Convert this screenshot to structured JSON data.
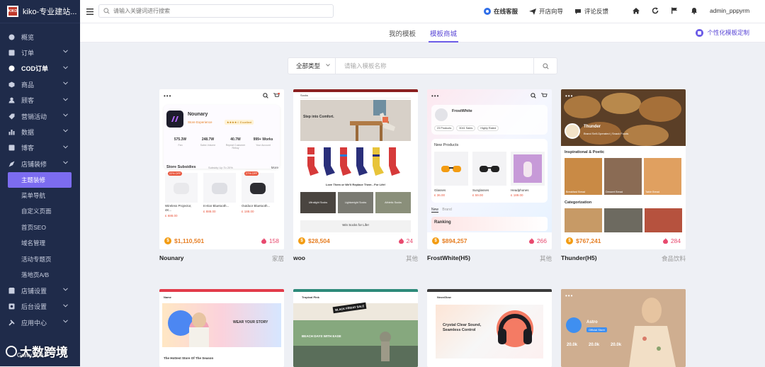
{
  "brand": {
    "name": "kiko-专业建站...",
    "logo_text": "KIKO"
  },
  "sidebar": {
    "items": [
      {
        "label": "概览",
        "icon": "dashboard-icon",
        "expandable": false
      },
      {
        "label": "订单",
        "icon": "order-icon",
        "expandable": true
      },
      {
        "label": "COD订单",
        "icon": "cod-icon",
        "expandable": true
      },
      {
        "label": "商品",
        "icon": "product-icon",
        "expandable": true
      },
      {
        "label": "顾客",
        "icon": "customer-icon",
        "expandable": true
      },
      {
        "label": "营销活动",
        "icon": "marketing-icon",
        "expandable": true
      },
      {
        "label": "数据",
        "icon": "data-icon",
        "expandable": true
      },
      {
        "label": "博客",
        "icon": "blog-icon",
        "expandable": true
      },
      {
        "label": "店铺装修",
        "icon": "decoration-icon",
        "expandable": true
      }
    ],
    "sub_items": [
      "主题装修",
      "菜单导航",
      "自定义页面",
      "首页SEO",
      "域名管理",
      "活动专题页",
      "落地页A/B"
    ],
    "bottom_items": [
      {
        "label": "店铺设置",
        "icon": "store-settings-icon"
      },
      {
        "label": "后台设置",
        "icon": "admin-settings-icon"
      },
      {
        "label": "应用中心",
        "icon": "app-center-icon"
      }
    ]
  },
  "topbar": {
    "search_placeholder": "请输入关键词进行搜索",
    "online_service": "在线客服",
    "guide": "开店向导",
    "feedback": "评论反馈",
    "username": "admin_pppyrm"
  },
  "tabs": {
    "mine": "我的模板",
    "market": "模板商城",
    "custom": "个性化模板定制"
  },
  "filter": {
    "type": "全部类型",
    "search_placeholder": "请输入模板名称"
  },
  "templates": [
    {
      "name": "Nounary",
      "category": "家居",
      "price": "$1,110,501",
      "likes": "158"
    },
    {
      "name": "woo",
      "category": "其他",
      "price": "$28,504",
      "likes": "24"
    },
    {
      "name": "FrostWhite(H5)",
      "category": "其他",
      "price": "$894,257",
      "likes": "266"
    },
    {
      "name": "Thunder(H5)",
      "category": "食品饮料",
      "price": "$767,241",
      "likes": "284"
    }
  ],
  "previews": {
    "nounary": {
      "title": "Nounary",
      "sub": "Store Experience",
      "badge": "Excellent",
      "stats": [
        [
          "575.3W",
          "Fan"
        ],
        [
          "248.7W",
          "Sales Volume"
        ],
        [
          "40.7W",
          "Repeat Customer Rebuy"
        ],
        [
          "999+ Works",
          "Your Account"
        ]
      ],
      "section": "Store Subsidies",
      "section_sub": "Subsidy Up To 20%",
      "more": "More",
      "products": [
        [
          "Wireless Projector, 4K...",
          "£ 688.00",
          "22% OFF"
        ],
        [
          "In-Ear Bluetooth...",
          "£ 888.00",
          ""
        ],
        [
          "Outdoor Bluetooth...",
          "£ 188.00",
          "27% OFF"
        ]
      ]
    },
    "woo": {
      "hero": "Step into Comfort.",
      "tagline": "Love Them or We'll Replace Them - For Life!",
      "bottom": "Win Socks for Life!",
      "boxes": [
        "Ultralight Socks",
        "Lightweight Socks",
        "Athletic Socks"
      ]
    },
    "frost": {
      "title": "FrostWhite",
      "chips": [
        "23 Products",
        "3041 Sales",
        "Highly Rated"
      ],
      "section": "New Products",
      "products": [
        [
          "Glasses",
          "£ 36.00"
        ],
        [
          "Sunglasses",
          "£ 59.00"
        ],
        [
          "Headphones",
          "£ 189.00"
        ]
      ],
      "tabs": [
        "New",
        "Brand"
      ],
      "ranking": "Ranking"
    },
    "thunder": {
      "name": "Thunder",
      "sub": "Brand Self-Operated | Snack Foods",
      "sec1": "Inspirational & Poetic",
      "items": [
        "Breakfast Bread",
        "Dessert Bread",
        "Table Bread"
      ],
      "sec2": "Categorization"
    },
    "row2": {
      "p1_hero": "WEAR YOUR STORY",
      "p1_sub": "The Hottest Store Of The Season",
      "p2_brand": "Tropical Pink",
      "p2_banner": "BEACH DAYS WITH EASE",
      "p2_sale": "BLACK FRIDAY SALE",
      "p3_brand": "NeonGlow",
      "p3_hero": "Crystal Clear Sound, Seamless Control",
      "p4_name": "Astro",
      "p4_sub": "Official Store",
      "p4_stats": [
        "20.0k",
        "20.0k",
        "20.0k"
      ]
    }
  },
  "watermark": {
    "text": "大数跨境",
    "sub": "Gravy 100"
  }
}
